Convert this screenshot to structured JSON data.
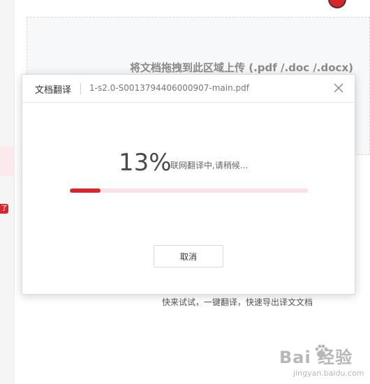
{
  "background": {
    "upload_prompt": "将文档拖拽到此区域上传 (.pdf /.doc /.docx)",
    "promo": "快来试试，一键翻译，快速导出译文文档",
    "sidebar_badge": "了"
  },
  "dialog": {
    "title": "文档翻译",
    "filename": "1-s2.0-S0013794406000907-main.pdf",
    "progress_text": "13%",
    "progress_value": 0.13,
    "status": "联网翻译中,请稍候...",
    "cancel_label": "取消"
  },
  "watermark": {
    "logo": "Bai  经验",
    "sub": "jingyan.baidu.com"
  },
  "colors": {
    "accent": "#d9262c",
    "track": "#f9e1e3",
    "dropzone_bg": "#f7f8fa"
  }
}
